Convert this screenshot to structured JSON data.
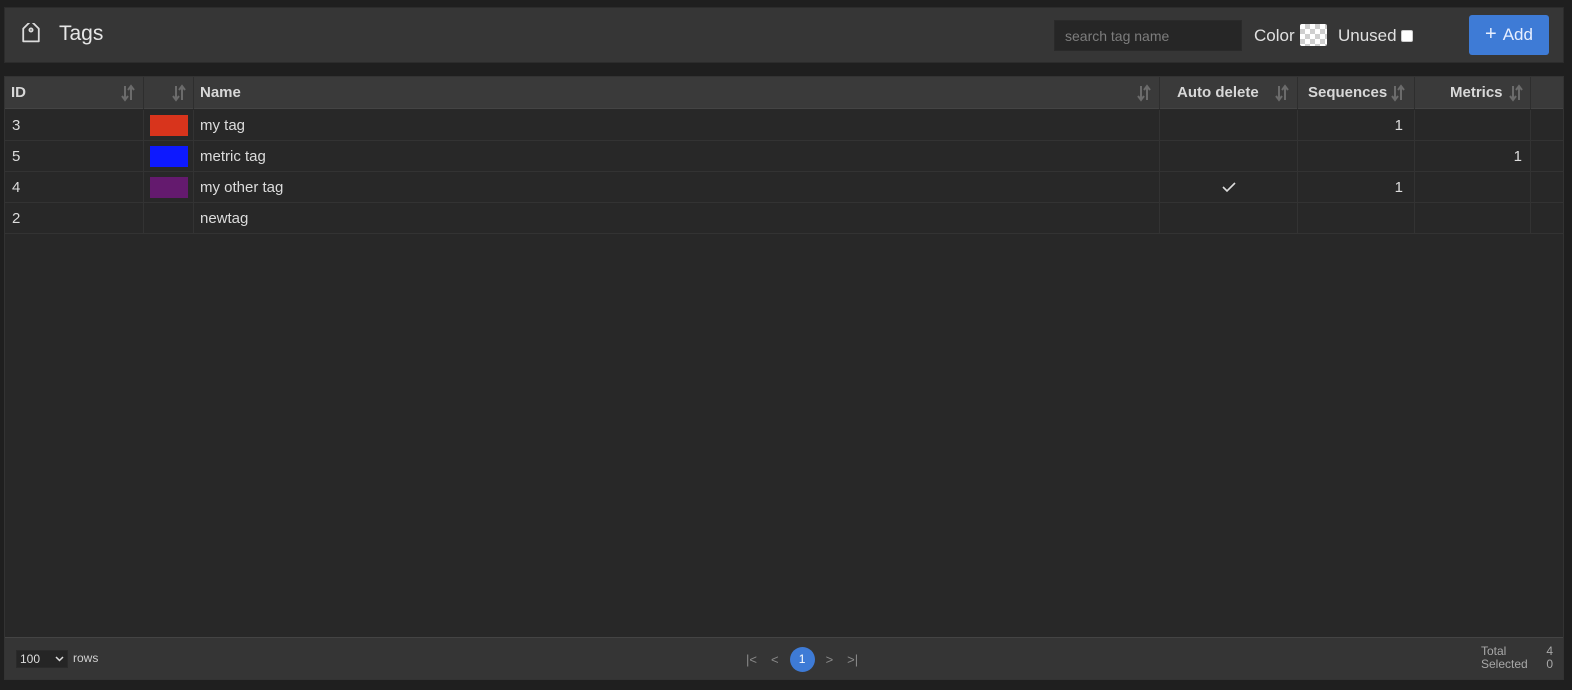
{
  "header": {
    "title": "Tags",
    "search_placeholder": "search tag name",
    "color_label": "Color",
    "unused_label": "Unused",
    "add_label": "Add",
    "accent": "#3e7bd6"
  },
  "table": {
    "columns": {
      "id": "ID",
      "color": "",
      "name": "Name",
      "auto_delete": "Auto delete",
      "sequences": "Sequences",
      "metrics": "Metrics"
    },
    "rows": [
      {
        "id": "3",
        "color": "#d8341c",
        "name": "my tag",
        "auto_delete": false,
        "sequences": "1",
        "metrics": ""
      },
      {
        "id": "5",
        "color": "#0d19ff",
        "name": "metric tag",
        "auto_delete": false,
        "sequences": "",
        "metrics": "1"
      },
      {
        "id": "4",
        "color": "#641a6e",
        "name": "my other tag",
        "auto_delete": true,
        "sequences": "1",
        "metrics": ""
      },
      {
        "id": "2",
        "color": "",
        "name": "newtag",
        "auto_delete": false,
        "sequences": "",
        "metrics": ""
      }
    ]
  },
  "footer": {
    "rows_per_page": "100",
    "rows_label": "rows",
    "pager": {
      "first": "|<",
      "prev": "<",
      "current": "1",
      "next": ">",
      "last": ">|"
    },
    "total_label": "Total",
    "total_value": "4",
    "selected_label": "Selected",
    "selected_value": "0"
  }
}
